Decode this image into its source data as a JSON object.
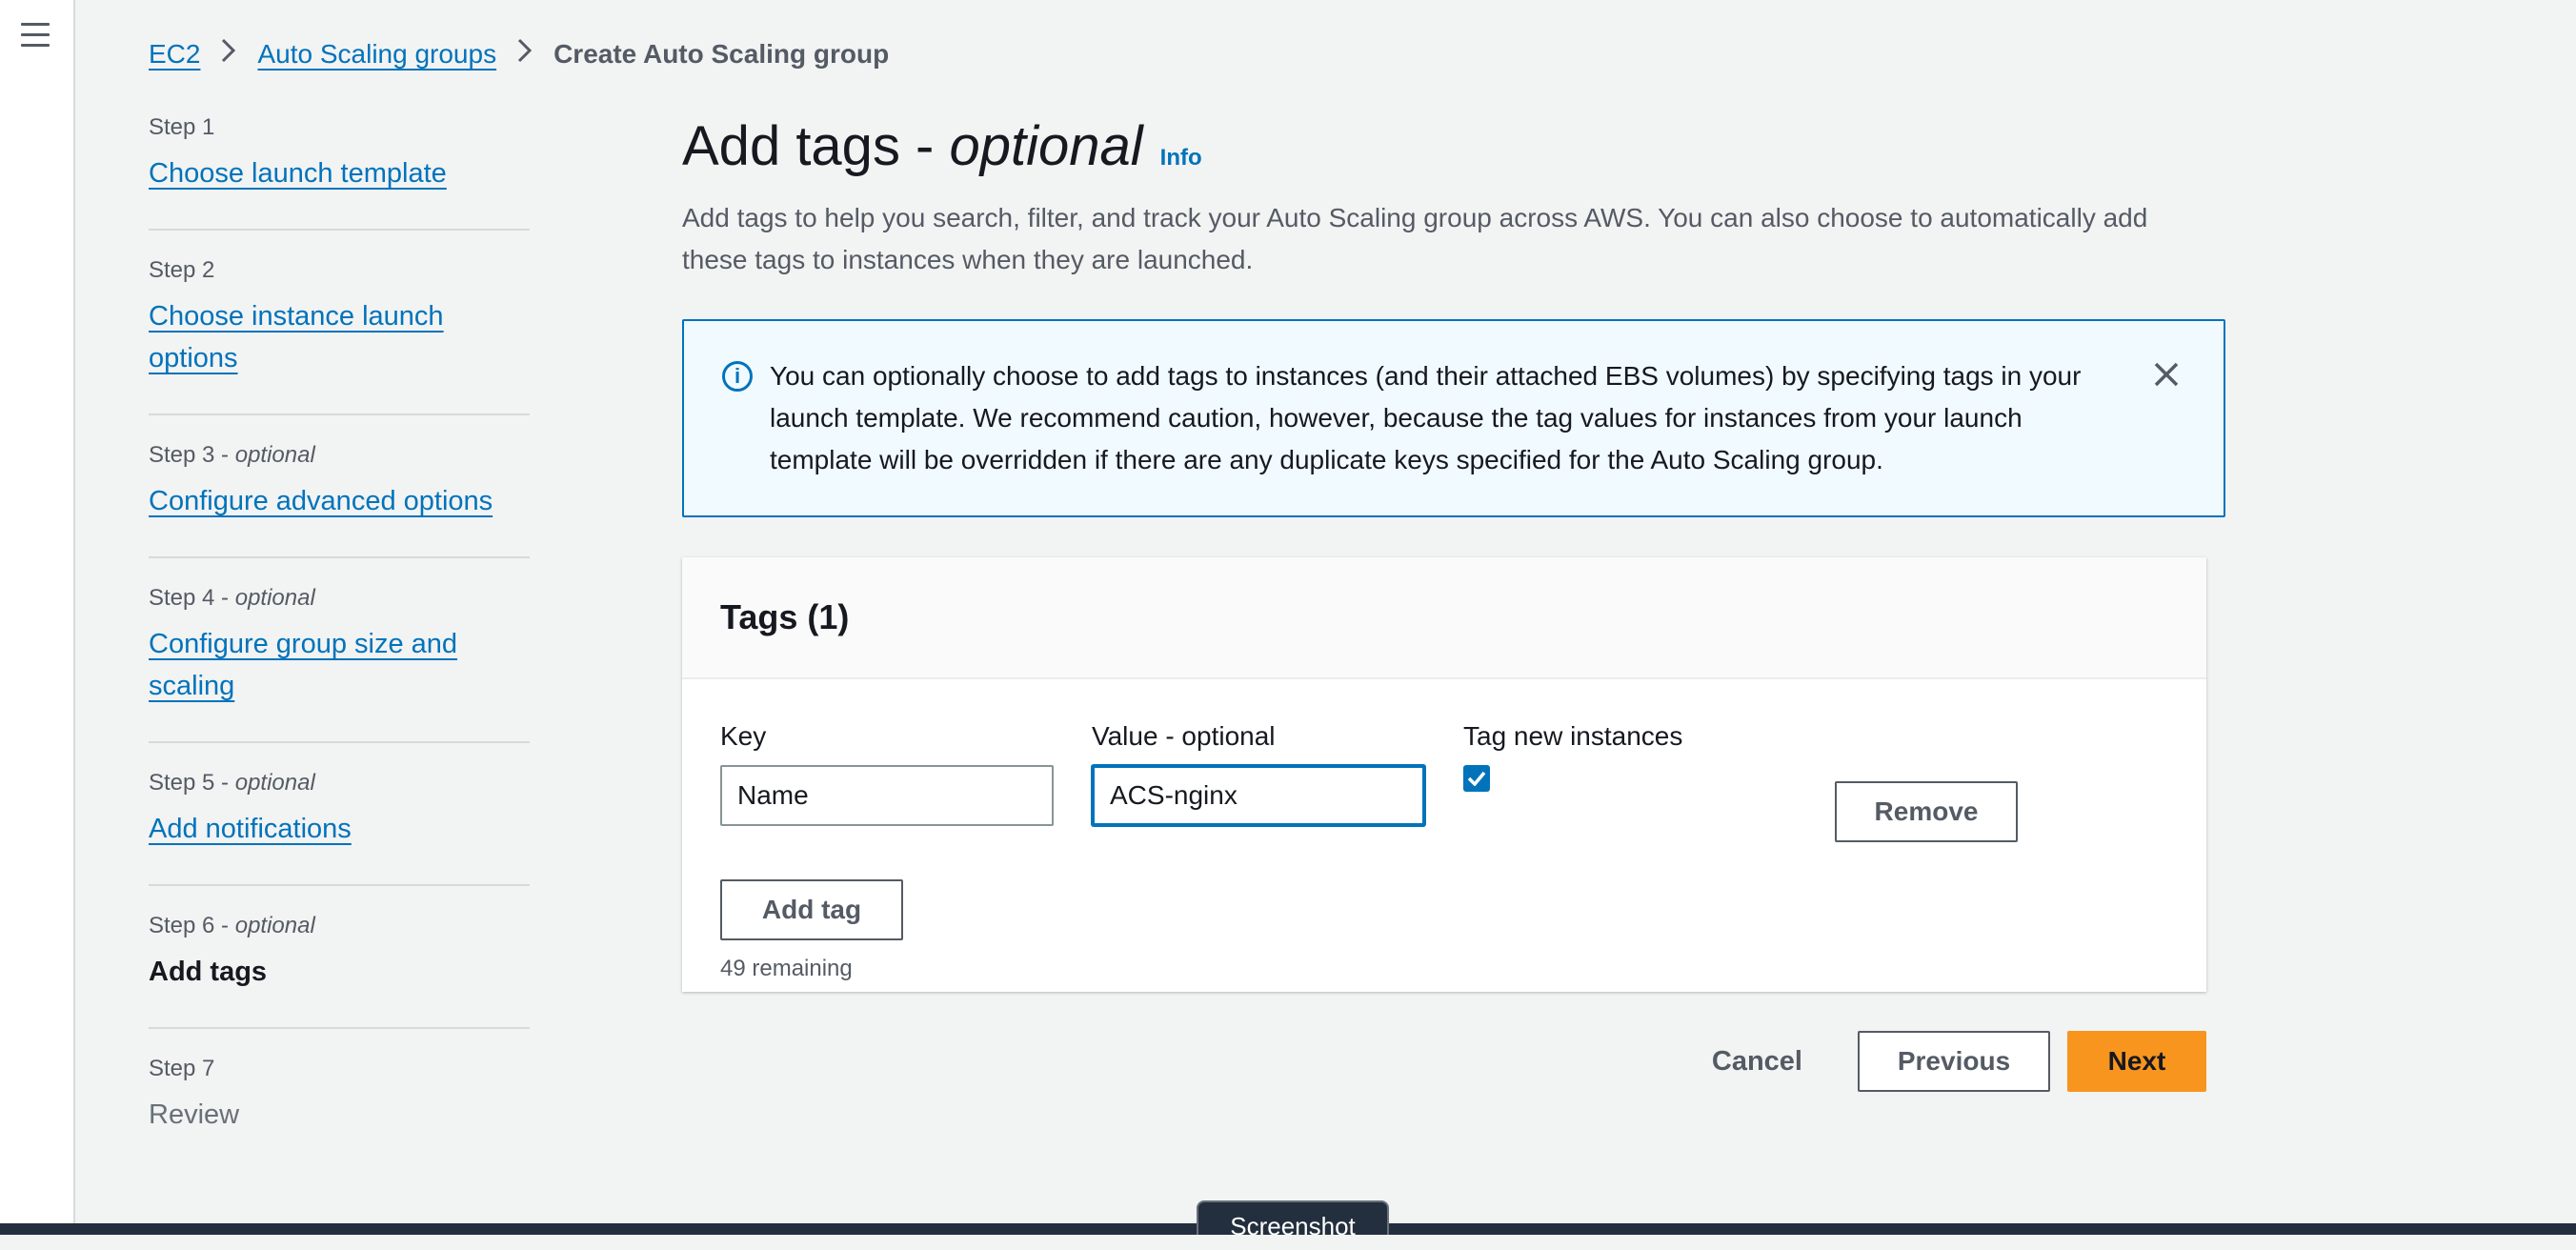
{
  "breadcrumb": {
    "items": [
      "EC2",
      "Auto Scaling groups"
    ],
    "current": "Create Auto Scaling group"
  },
  "steps": [
    {
      "label": "Step 1",
      "optional": "",
      "title": "Choose launch template",
      "state": "link"
    },
    {
      "label": "Step 2",
      "optional": "",
      "title": "Choose instance launch options",
      "state": "link"
    },
    {
      "label": "Step 3 - ",
      "optional": "optional",
      "title": "Configure advanced options",
      "state": "link"
    },
    {
      "label": "Step 4 - ",
      "optional": "optional",
      "title": "Configure group size and scaling",
      "state": "link"
    },
    {
      "label": "Step 5 - ",
      "optional": "optional",
      "title": "Add notifications",
      "state": "link"
    },
    {
      "label": "Step 6 - ",
      "optional": "optional",
      "title": "Add tags",
      "state": "active"
    },
    {
      "label": "Step 7",
      "optional": "",
      "title": "Review",
      "state": "disabled"
    }
  ],
  "page": {
    "title_main": "Add tags - ",
    "title_italic": "optional",
    "info": "Info",
    "subtitle": "Add tags to help you search, filter, and track your Auto Scaling group across AWS. You can also choose to automatically add these tags to instances when they are launched."
  },
  "alert": {
    "text": "You can optionally choose to add tags to instances (and their attached EBS volumes) by specifying tags in your launch template. We recommend caution, however, because the tag values for instances from your launch template will be overridden if there are any duplicate keys specified for the Auto Scaling group."
  },
  "tags": {
    "header": "Tags (1)",
    "key_label": "Key",
    "value_label": "Value - optional",
    "tag_new_label": "Tag new instances",
    "rows": [
      {
        "key": "Name",
        "value": "ACS-nginx",
        "tag_new_instances": true
      }
    ],
    "remove_label": "Remove",
    "add_label": "Add tag",
    "remaining": "49 remaining"
  },
  "actions": {
    "cancel": "Cancel",
    "previous": "Previous",
    "next": "Next"
  },
  "overlay": {
    "screenshot_label": "Screenshot"
  },
  "colors": {
    "link": "#0073bb",
    "primary_button": "#f7951f",
    "background": "#f2f3f3"
  }
}
